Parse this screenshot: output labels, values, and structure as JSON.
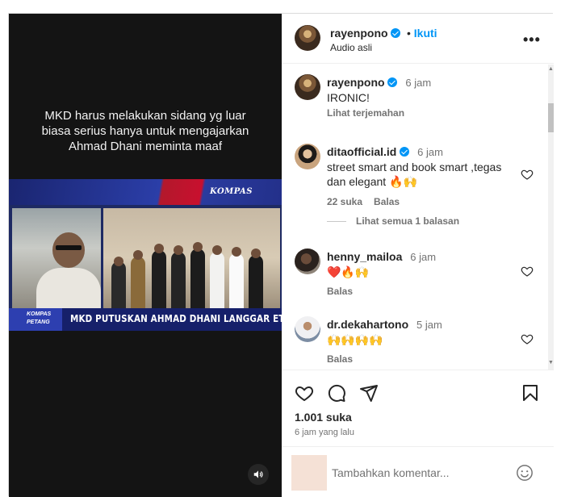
{
  "video": {
    "caption": "MKD harus melakukan sidang yg luar biasa serius hanya untuk mengajarkan Ahmad Dhani meminta maaf",
    "network_logo": "KOMPAS",
    "program_logo_line1": "KOMPAS",
    "program_logo_line2": "PETANG",
    "headline": "MKD PUTUSKAN AHMAD DHANI LANGGAR ETIK DPR",
    "mute_icon": "speaker-icon"
  },
  "post": {
    "author": "rayenpono",
    "follow_label": "Ikuti",
    "audio": "Audio asli",
    "more_icon": "•••"
  },
  "comments": [
    {
      "user": "rayenpono",
      "time": "6 jam",
      "text": "IRONIC!",
      "meta": [
        "Lihat terjemahan"
      ],
      "verified": true
    },
    {
      "user": "ditaofficial.id",
      "time": "6 jam",
      "text": "street smart and book smart ,tegas dan elegant 🔥🙌",
      "meta": [
        "22 suka",
        "Balas"
      ],
      "verified": true
    },
    {
      "user": "henny_mailoa",
      "time": "6 jam",
      "text": "❤️🔥🙌",
      "meta": [
        "Balas"
      ],
      "verified": false
    },
    {
      "user": "dr.dekahartono",
      "time": "5 jam",
      "text": "🙌🙌🙌🙌",
      "meta": [
        "Balas"
      ],
      "verified": false
    }
  ],
  "view_replies": "Lihat semua 1 balasan",
  "stats": {
    "likes": "1.001 suka",
    "posted": "6 jam yang lalu"
  },
  "add_comment": {
    "placeholder": "Tambahkan komentar..."
  },
  "colors": {
    "accent": "#0095f6",
    "muted_text": "#737373",
    "video_bg": "#141414"
  }
}
